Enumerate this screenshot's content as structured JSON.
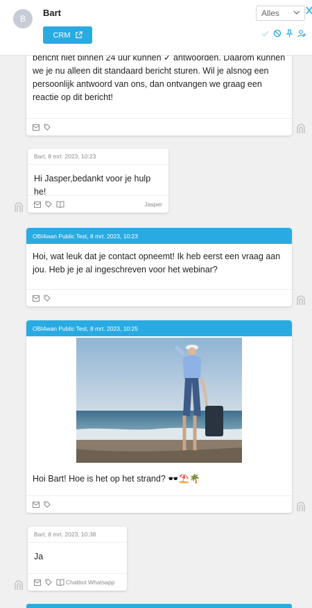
{
  "header": {
    "avatar_initial": "B",
    "contact_name": "Bart",
    "crm_label": "CRM",
    "filter_value": "Alles"
  },
  "messages": [
    {
      "id": "m1",
      "text": "bericht niet binnen 24 uur kunnen ✓ antwoorden. Daarom kunnen we je nu alleen dit standaard bericht sturen. Wil je alsnog een persoonlijk antwoord van ons, dan ontvangen we graag een reactie op dit bericht!"
    },
    {
      "id": "m2",
      "meta": "Bart, 8 mrt. 2023, 10:23",
      "text": "Hi Jasper,bedankt voor je hulp he!",
      "agent": "Jasper"
    },
    {
      "id": "m3",
      "meta": "OBI4wan Public Test, 8 mrt. 2023, 10:23",
      "text": "Hoi, wat leuk dat je contact opneemt! Ik heb eerst een vraag aan jou. Heb je je al ingeschreven voor het webinar?"
    },
    {
      "id": "m4",
      "meta": "OBI4wan Public Test, 8 mrt. 2023, 10:25",
      "text": "Hoi Bart! Hoe is het op het strand? 🕶️⛱️🌴"
    },
    {
      "id": "m5",
      "meta": "Bart, 8 mrt. 2023, 10:38",
      "text": "Ja",
      "tag": "Chatbot Whatsapp"
    }
  ],
  "colors": {
    "accent": "#29abe2",
    "background": "#f0f0f1"
  }
}
